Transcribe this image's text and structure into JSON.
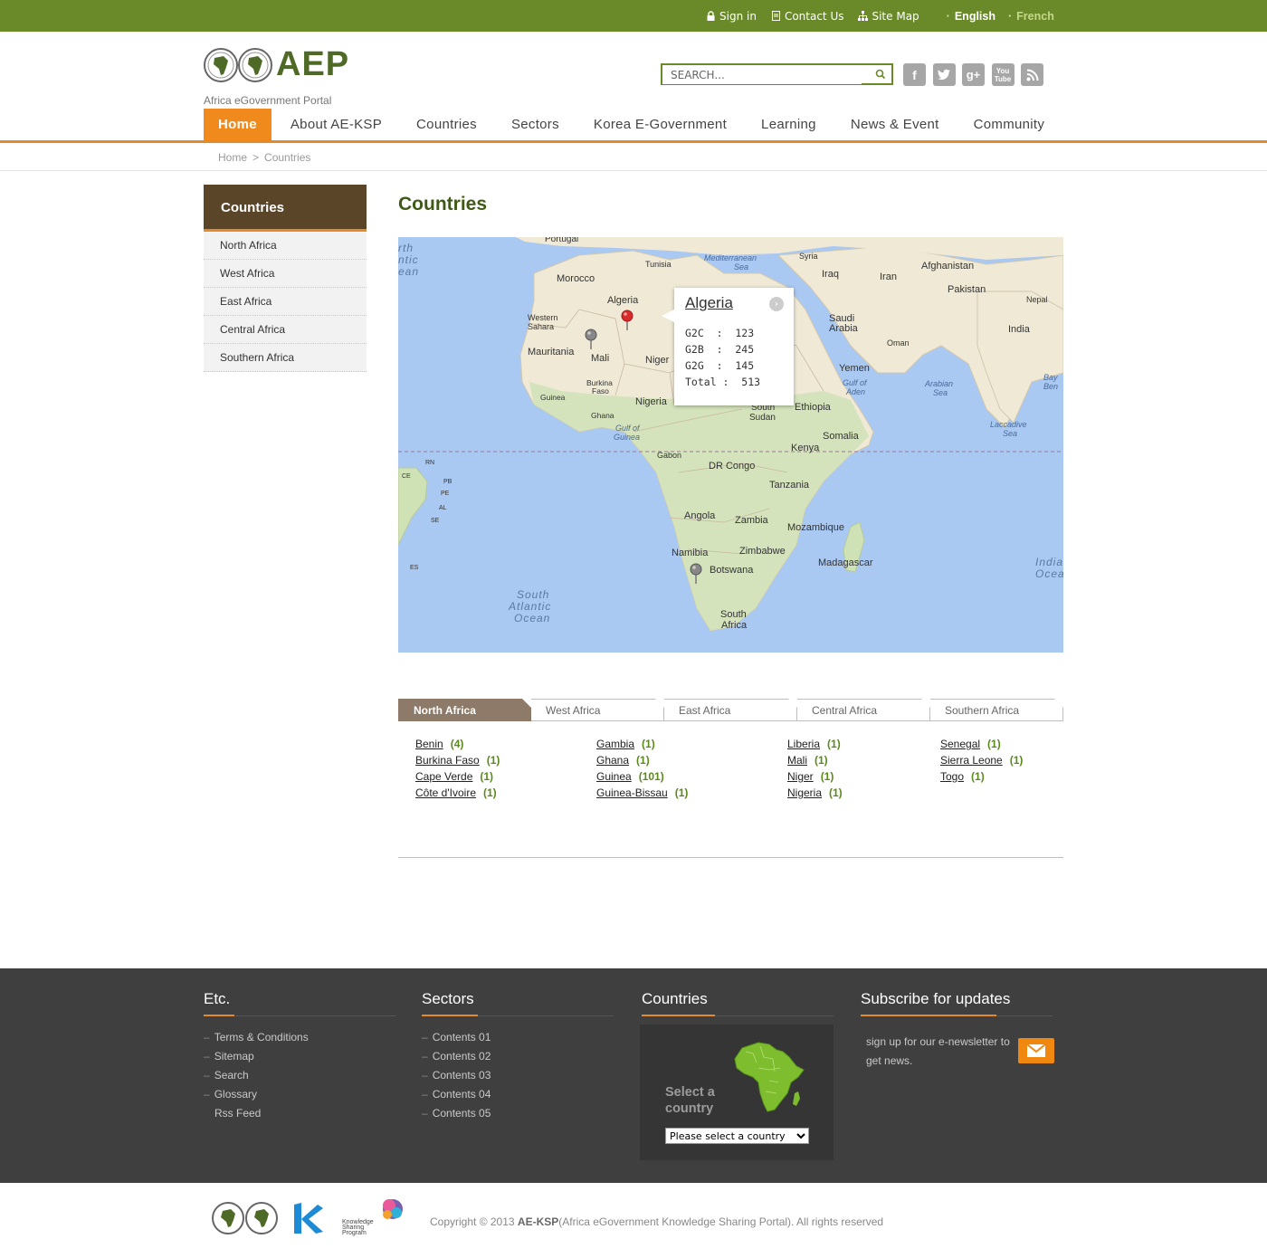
{
  "topbar": {
    "sign_in": "Sign in",
    "contact_us": "Contact Us",
    "site_map": "Site Map",
    "lang_english": "English",
    "lang_french": "French"
  },
  "header": {
    "logo_text": "AEP",
    "logo_sub": "Africa eGovernment Portal",
    "search_placeholder": "SEARCH..."
  },
  "nav": [
    {
      "label": "Home",
      "active": true
    },
    {
      "label": "About  AE-KSP"
    },
    {
      "label": "Countries"
    },
    {
      "label": "Sectors"
    },
    {
      "label": "Korea E-Government"
    },
    {
      "label": "Learning"
    },
    {
      "label": "News & Event"
    },
    {
      "label": "Community"
    }
  ],
  "breadcrumb": {
    "home": "Home",
    "sep": ">",
    "current": "Countries"
  },
  "sidebar": {
    "title": "Countries",
    "items": [
      "North Africa",
      "West Africa",
      "East Africa",
      "Central Africa",
      "Southern Africa"
    ]
  },
  "page_title": "Countries",
  "map": {
    "labels": {
      "portugal": "Portugal",
      "tunisia": "Tunisia",
      "morocco": "Morocco",
      "algeria": "Algeria",
      "western_sahara_1": "Western",
      "western_sahara_2": "Sahara",
      "mauritania": "Mauritania",
      "mali": "Mali",
      "niger": "Niger",
      "burkina_1": "Burkina",
      "burkina_2": "Faso",
      "guinea": "Guinea",
      "ghana": "Ghana",
      "nigeria": "Nigeria",
      "gulf_guinea_1": "Gulf of",
      "gulf_guinea_2": "Guinea",
      "gabon": "Gabon",
      "dr_congo": "DR Congo",
      "angola": "Angola",
      "zambia": "Zambia",
      "tanzania": "Tanzania",
      "kenya": "Kenya",
      "somalia": "Somalia",
      "ethiopia": "Ethiopia",
      "south_sudan_1": "South",
      "south_sudan_2": "Sudan",
      "mozambique": "Mozambique",
      "madagascar": "Madagascar",
      "zimbabwe": "Zimbabwe",
      "namibia": "Namibia",
      "botswana": "Botswana",
      "south_africa_1": "South",
      "south_africa_2": "Africa",
      "mediterranean_1": "Mediterranean",
      "mediterranean_2": "Sea",
      "syria": "Syria",
      "iraq": "Iraq",
      "iran": "Iran",
      "afghanistan": "Afghanistan",
      "pakistan": "Pakistan",
      "nepal": "Nepal",
      "india": "India",
      "saudi_1": "Saudi",
      "saudi_2": "Arabia",
      "oman": "Oman",
      "yemen": "Yemen",
      "gulf_aden_1": "Gulf of",
      "gulf_aden_2": "Aden",
      "arabian_1": "Arabian",
      "arabian_2": "Sea",
      "laccadive_1": "Laccadive",
      "laccadive_2": "Sea",
      "bay_1": "Bay",
      "bay_2": "Ben",
      "indian_1": "India",
      "indian_2": "Ocea",
      "south_atlantic_1": "South",
      "south_atlantic_2": "Atlantic",
      "south_atlantic_3": "Ocean",
      "north_1": "rth",
      "north_2": "ntic",
      "north_3": "ean",
      "rn": "RN",
      "ce": "CE",
      "pb": "PB",
      "pe": "PE",
      "al": "AL",
      "se": "SE",
      "es": "ES"
    },
    "popup": {
      "title": "Algeria",
      "g2c": "G2C  :  123",
      "g2b": "G2B  :  245",
      "g2g": "G2G  :  145",
      "total": "Total :  513"
    }
  },
  "tabs": [
    "North Africa",
    "West Africa",
    "East Africa",
    "Central Africa",
    "Southern Africa"
  ],
  "countries": [
    [
      {
        "name": "Benin",
        "count": "(4)"
      },
      {
        "name": "Burkina Faso",
        "count": "(1)"
      },
      {
        "name": "Cape Verde",
        "count": "(1)"
      },
      {
        "name": "Côte d'Ivoire",
        "count": "(1)"
      }
    ],
    [
      {
        "name": "Gambia",
        "count": "(1)"
      },
      {
        "name": "Ghana",
        "count": "(1)"
      },
      {
        "name": "Guinea",
        "count": "(101)"
      },
      {
        "name": "Guinea-Bissau",
        "count": "(1)"
      }
    ],
    [
      {
        "name": "Liberia",
        "count": "(1)"
      },
      {
        "name": "Mali",
        "count": "(1)"
      },
      {
        "name": "Niger",
        "count": "(1)"
      },
      {
        "name": "Nigeria",
        "count": "(1)"
      }
    ],
    [
      {
        "name": "Senegal",
        "count": "(1)"
      },
      {
        "name": "Sierra Leone",
        "count": "(1)"
      },
      {
        "name": "Togo",
        "count": "(1)"
      }
    ]
  ],
  "footer": {
    "etc": {
      "title": "Etc.",
      "items": [
        "Terms & Conditions",
        "Sitemap",
        "Search",
        "Glossary",
        "Rss Feed"
      ]
    },
    "sectors": {
      "title": "Sectors",
      "items": [
        "Contents 01",
        "Contents 02",
        "Contents 03",
        "Contents 04",
        "Contents 05"
      ]
    },
    "countries": {
      "title": "Countries",
      "select_label": "Select a country",
      "select_value": "Please select a country"
    },
    "subscribe": {
      "title": "Subscribe for updates",
      "text": "sign up for our e-newsletter to get news."
    }
  },
  "copyright": {
    "prefix": "Copyright © 2013 ",
    "brand": "AE-KSP",
    "suffix": "(Africa eGovernment Knowledge Sharing Portal). All rights reserved"
  },
  "colors": {
    "topbar": "#6a8a2a",
    "accent_orange": "#f08a1c",
    "sidebar_head": "#5a4528",
    "title_green": "#3f5a16",
    "count_green": "#5a8a1a",
    "footer_bg": "#3f3f3f",
    "ocean": "#a9c8f2",
    "land": "#efe9d6"
  },
  "icons": [
    "lock-icon",
    "document-icon",
    "sitemap-icon",
    "search-icon",
    "facebook-icon",
    "twitter-icon",
    "googleplus-icon",
    "youtube-icon",
    "rss-icon",
    "map-pin-icon",
    "mail-icon",
    "chevron-right-icon"
  ]
}
